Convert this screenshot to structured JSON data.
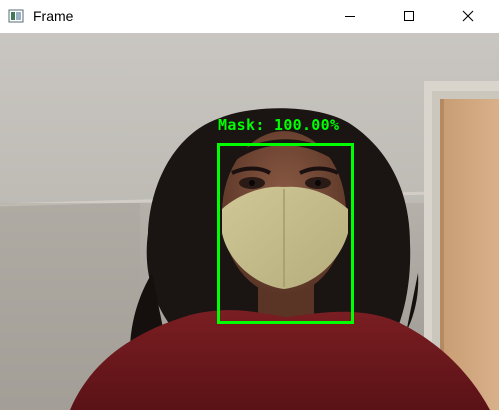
{
  "window": {
    "title": "Frame",
    "icon": "opencv-frame-icon",
    "controls": [
      "minimize-icon",
      "maximize-icon",
      "close-icon"
    ]
  },
  "detection": {
    "label": "Mask: 100.00%",
    "box_color": "#00ff00"
  }
}
